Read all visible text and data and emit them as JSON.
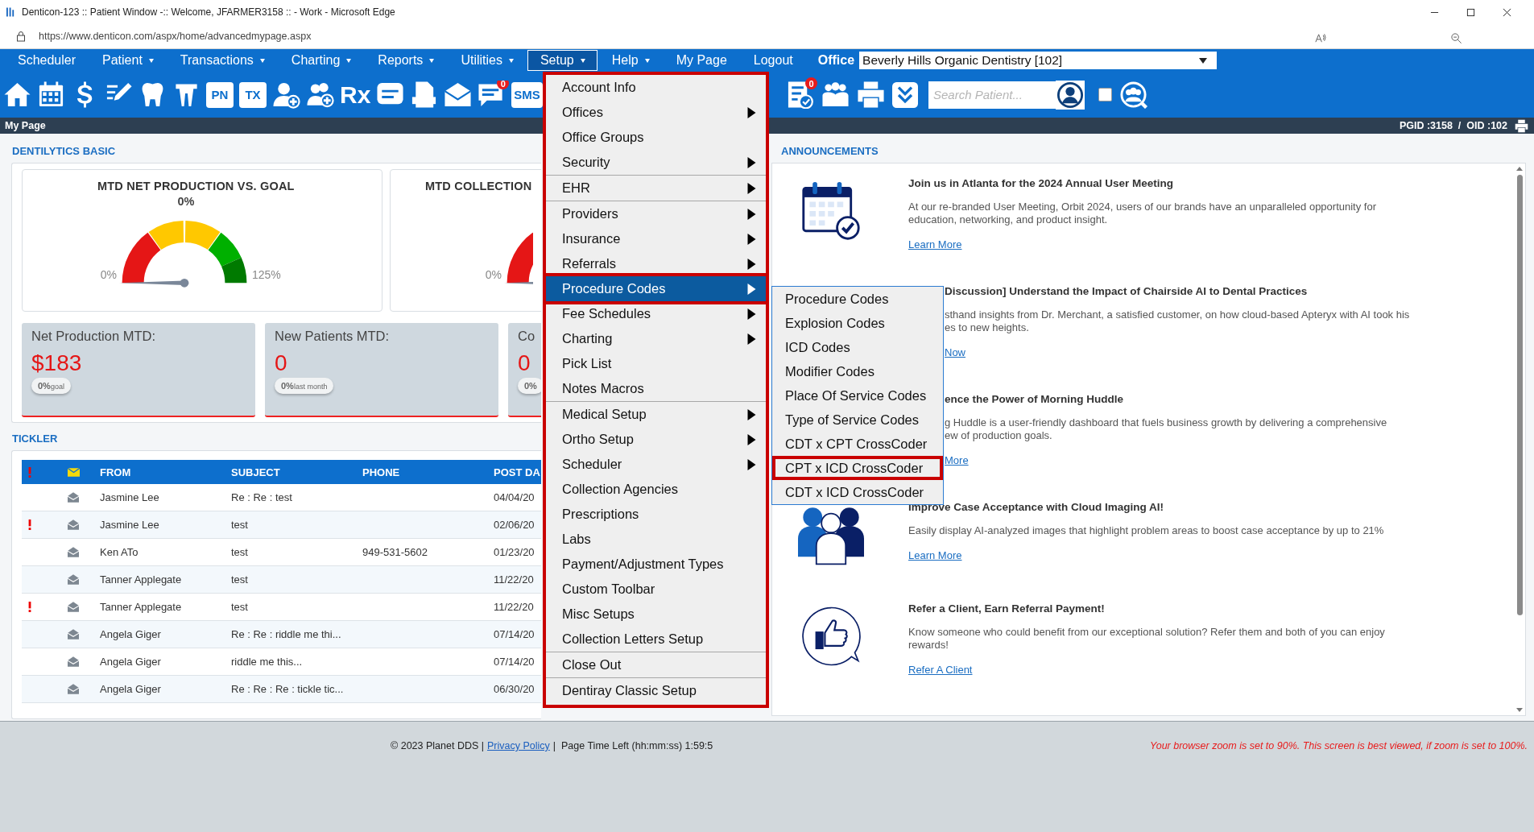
{
  "browser": {
    "title": "Denticon-123 :: Patient Window -:: Welcome, JFARMER3158 :: - Work - Microsoft Edge",
    "url": "https://www.denticon.com/aspx/home/advancedmypage.aspx"
  },
  "nav": {
    "items": [
      {
        "label": "Scheduler",
        "dropdown": false,
        "selected": false
      },
      {
        "label": "Patient",
        "dropdown": true,
        "selected": false
      },
      {
        "label": "Transactions",
        "dropdown": true,
        "selected": false
      },
      {
        "label": "Charting",
        "dropdown": true,
        "selected": false
      },
      {
        "label": "Reports",
        "dropdown": true,
        "selected": false
      },
      {
        "label": "Utilities",
        "dropdown": true,
        "selected": false
      },
      {
        "label": "Setup",
        "dropdown": true,
        "selected": true
      },
      {
        "label": "Help",
        "dropdown": true,
        "selected": false
      },
      {
        "label": "My Page",
        "dropdown": false,
        "selected": false
      },
      {
        "label": "Logout",
        "dropdown": false,
        "selected": false
      }
    ],
    "office_label": "Office",
    "office_value": "Beverly Hills Organic Dentistry [102]"
  },
  "toolbar": {
    "left": [
      {
        "kind": "home"
      },
      {
        "kind": "calendar"
      },
      {
        "kind": "dollar"
      },
      {
        "kind": "pencil"
      },
      {
        "kind": "tooth"
      },
      {
        "kind": "implant"
      },
      {
        "kind": "tile",
        "label": "PN"
      },
      {
        "kind": "tile",
        "label": "TX"
      },
      {
        "kind": "person-plus"
      },
      {
        "kind": "people-plus"
      },
      {
        "kind": "glyph",
        "label": "Rx"
      },
      {
        "kind": "note"
      },
      {
        "kind": "document"
      },
      {
        "kind": "envelope"
      },
      {
        "kind": "chat",
        "badge": "0"
      },
      {
        "kind": "tile",
        "label": "SMS"
      }
    ],
    "right": [
      {
        "kind": "checklist",
        "badge": "0"
      },
      {
        "kind": "people"
      },
      {
        "kind": "printer"
      },
      {
        "kind": "chevron"
      }
    ],
    "search_placeholder": "Search Patient...",
    "checkbox_checked": false
  },
  "subbar": {
    "title": "My Page",
    "ids": "PGID :3158  /  OID :102"
  },
  "dentilytics": {
    "title": "DENTILYTICS BASIC",
    "gauges": [
      {
        "title": "MTD NET PRODUCTION VS. GOAL",
        "value": "0%",
        "min": "0%",
        "max": "125%"
      },
      {
        "title": "MTD COLLECTION",
        "min": "0%"
      }
    ],
    "stats": [
      {
        "label": "Net Production MTD:",
        "value": "$183",
        "pct": "0%",
        "note": "goal"
      },
      {
        "label": "New Patients MTD:",
        "value": "0",
        "pct": "0%",
        "note": "last month"
      },
      {
        "label": "Co",
        "value": "0",
        "pct": "0%"
      }
    ]
  },
  "tickler": {
    "title": "TICKLER",
    "columns": [
      "FROM",
      "SUBJECT",
      "PHONE",
      "POST DA"
    ],
    "rows": [
      {
        "urgent": false,
        "from": "Jasmine Lee",
        "subject": "Re : Re : test",
        "phone": "",
        "date": "04/04/20"
      },
      {
        "urgent": true,
        "from": "Jasmine Lee",
        "subject": "test",
        "phone": "",
        "date": "02/06/20"
      },
      {
        "urgent": false,
        "from": "Ken ATo",
        "subject": "test",
        "phone": "949-531-5602",
        "date": "01/23/20"
      },
      {
        "urgent": false,
        "from": "Tanner Applegate",
        "subject": "test",
        "phone": "",
        "date": "11/22/20"
      },
      {
        "urgent": true,
        "from": "Tanner Applegate",
        "subject": "test",
        "phone": "",
        "date": "11/22/20"
      },
      {
        "urgent": false,
        "from": "Angela Giger",
        "subject": "Re : Re : riddle me thi...",
        "phone": "",
        "date": "07/14/20"
      },
      {
        "urgent": false,
        "from": "Angela Giger",
        "subject": "riddle me this...",
        "phone": "",
        "date": "07/14/20"
      },
      {
        "urgent": false,
        "from": "Angela Giger",
        "subject": "Re : Re : Re : tickle tic...",
        "phone": "",
        "date": "06/30/20"
      }
    ]
  },
  "announcements": {
    "title": "ANNOUNCEMENTS",
    "items": [
      {
        "kind": "calendar",
        "title": "Join us in Atlanta for the 2024 Annual User Meeting",
        "lines": [
          "At our re-branded User Meeting, Orbit 2024, users of our brands have an unparalleled opportunity for",
          "education, networking, and product insight."
        ],
        "link": "Learn More"
      },
      {
        "kind": "covered",
        "title": "Discussion] Understand the Impact of Chairside AI to Dental Practices",
        "lines": [
          "sthand insights from Dr. Merchant, a satisfied customer, on how cloud-based Apteryx with AI took his",
          "es to new heights."
        ],
        "link": "Now"
      },
      {
        "kind": "covered",
        "title": "ence the Power of Morning Huddle",
        "lines": [
          "g Huddle is a user-friendly dashboard that fuels business growth by delivering a comprehensive",
          "ew of production goals."
        ],
        "link": "More"
      },
      {
        "kind": "people",
        "title": "Improve Case Acceptance with Cloud Imaging AI!",
        "lines": [
          "Easily display AI-analyzed images that highlight problem areas to boost case acceptance by up to 21%"
        ],
        "link": "Learn More"
      },
      {
        "kind": "thumbs",
        "title": "Refer a Client, Earn Referral Payment!",
        "lines": [
          "Know someone who could benefit from our exceptional solution? Refer them and both of you can enjoy",
          "rewards!"
        ],
        "link": "Refer A Client"
      }
    ]
  },
  "setup_menu": {
    "groups": [
      [
        {
          "label": "Account Info",
          "submenu": false,
          "selected": false
        },
        {
          "label": "Offices",
          "submenu": true,
          "selected": false
        },
        {
          "label": "Office Groups",
          "submenu": false,
          "selected": false
        },
        {
          "label": "Security",
          "submenu": true,
          "selected": false
        }
      ],
      [
        {
          "label": "EHR",
          "submenu": true,
          "selected": false
        }
      ],
      [
        {
          "label": "Providers",
          "submenu": true,
          "selected": false
        },
        {
          "label": "Insurance",
          "submenu": true,
          "selected": false
        },
        {
          "label": "Referrals",
          "submenu": true,
          "selected": false
        },
        {
          "label": "Procedure Codes",
          "submenu": true,
          "selected": true
        },
        {
          "label": "Fee Schedules",
          "submenu": true,
          "selected": false
        },
        {
          "label": "Charting",
          "submenu": true,
          "selected": false
        },
        {
          "label": "Pick List",
          "submenu": false,
          "selected": false
        },
        {
          "label": "Notes Macros",
          "submenu": false,
          "selected": false
        }
      ],
      [
        {
          "label": "Medical Setup",
          "submenu": true,
          "selected": false
        },
        {
          "label": "Ortho Setup",
          "submenu": true,
          "selected": false
        },
        {
          "label": "Scheduler",
          "submenu": true,
          "selected": false
        },
        {
          "label": "Collection Agencies",
          "submenu": false,
          "selected": false
        },
        {
          "label": "Prescriptions",
          "submenu": false,
          "selected": false
        },
        {
          "label": "Labs",
          "submenu": false,
          "selected": false
        },
        {
          "label": "Payment/Adjustment Types",
          "submenu": false,
          "selected": false
        },
        {
          "label": "Custom Toolbar",
          "submenu": false,
          "selected": false
        },
        {
          "label": "Misc Setups",
          "submenu": false,
          "selected": false
        },
        {
          "label": "Collection Letters Setup",
          "submenu": false,
          "selected": false
        }
      ],
      [
        {
          "label": "Close Out",
          "submenu": false,
          "selected": false
        }
      ],
      [
        {
          "label": "Dentiray Classic Setup",
          "submenu": false,
          "selected": false
        }
      ]
    ]
  },
  "procedure_submenu": {
    "items": [
      {
        "label": "Procedure Codes",
        "highlighted": false
      },
      {
        "label": "Explosion Codes",
        "highlighted": false
      },
      {
        "label": "ICD Codes",
        "highlighted": false
      },
      {
        "label": "Modifier Codes",
        "highlighted": false
      },
      {
        "label": "Place Of Service Codes",
        "highlighted": false
      },
      {
        "label": "Type of Service Codes",
        "highlighted": false
      },
      {
        "label": "CDT x CPT CrossCoder",
        "highlighted": false
      },
      {
        "label": "CPT x ICD CrossCoder",
        "highlighted": true
      },
      {
        "label": "CDT x ICD CrossCoder",
        "highlighted": false
      }
    ]
  },
  "footer": {
    "copyright": "© 2023 Planet DDS |",
    "link": "Privacy Policy",
    "timer": "|  Page Time Left (hh:mm:ss) 1:59:5",
    "warning": "Your browser zoom is set to 90%. This screen is best viewed, if zoom is set to 100%."
  }
}
